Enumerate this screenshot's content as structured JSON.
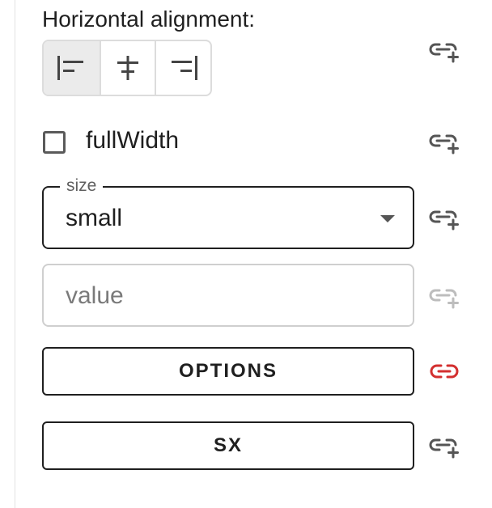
{
  "properties": {
    "horizontal_alignment": {
      "label": "Horizontal alignment:",
      "options": [
        "align-left",
        "align-center",
        "align-right"
      ],
      "selected": "align-left"
    },
    "full_width": {
      "label": "fullWidth",
      "checked": false
    },
    "size": {
      "legend": "size",
      "value": "small"
    },
    "value_field": {
      "placeholder": "value",
      "value": ""
    },
    "options_button": {
      "label": "OPTIONS"
    },
    "sx_button": {
      "label": "SX"
    }
  },
  "link_icons": {
    "icon": "link-add-icon",
    "default_color": "#555555",
    "disabled_color": "#bdbdbd",
    "bound_color": "#d32f2f"
  }
}
